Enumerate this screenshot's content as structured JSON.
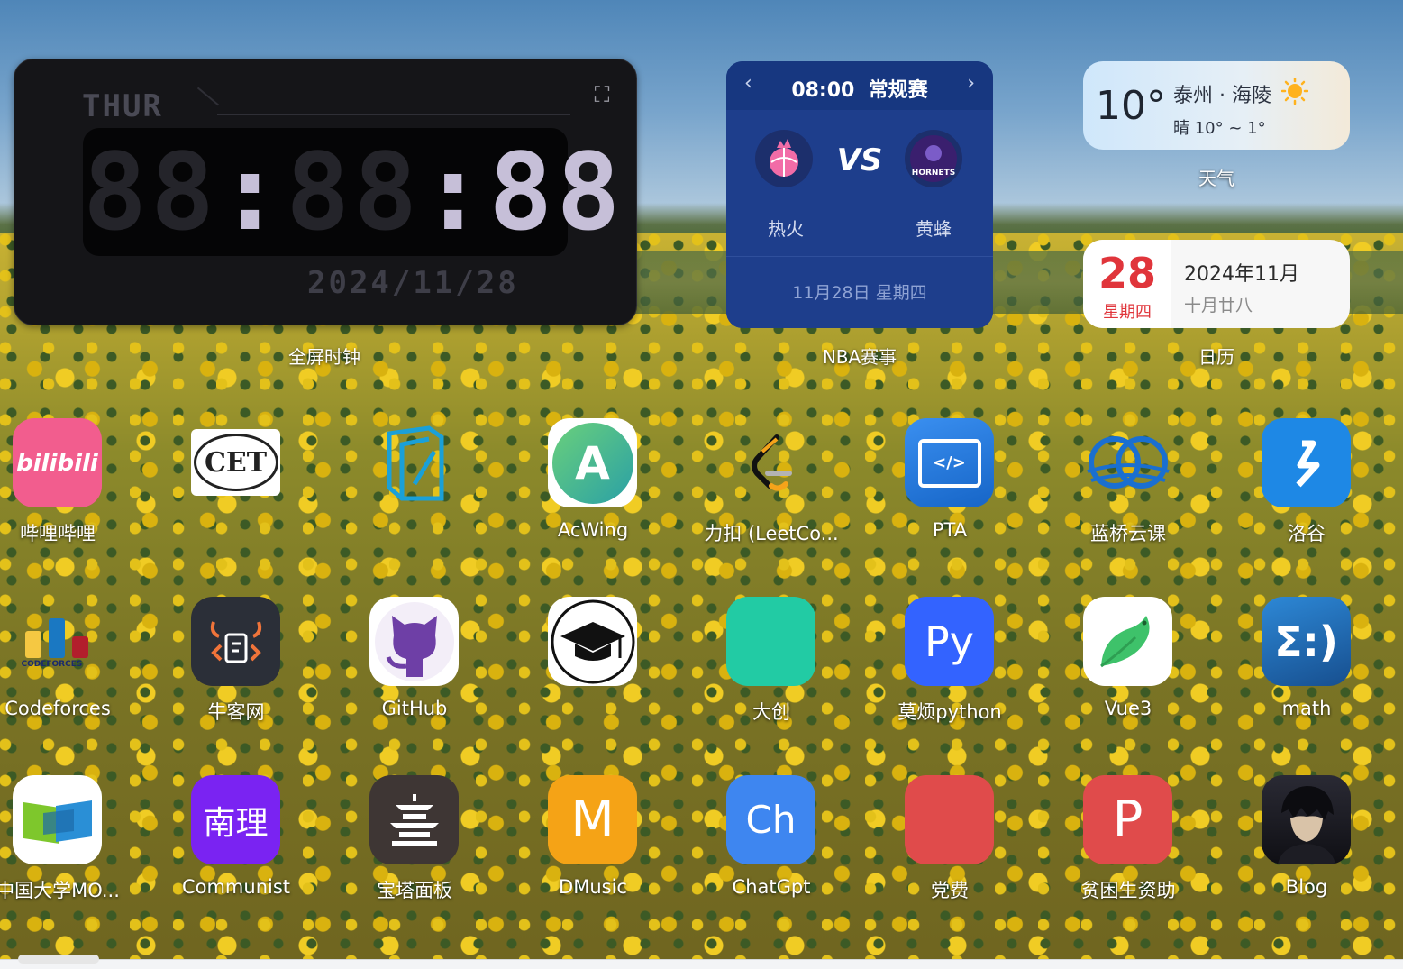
{
  "widgets": {
    "clock": {
      "day": "THUR",
      "time_dim": "88",
      "time_lit": "",
      "date": "2024/11/28",
      "label": "全屏时钟"
    },
    "nba": {
      "time": "08:00",
      "stage": "常规赛",
      "vs": "VS",
      "home_team": "热火",
      "away_team": "黄蜂",
      "away_logo_text": "HORNETS",
      "date": "11月28日  星期四",
      "label": "NBA赛事"
    },
    "weather": {
      "temp": "10°",
      "city": "泰州 · 海陵",
      "range": "晴 10° ~ 1°",
      "label": "天气"
    },
    "calendar": {
      "day": "28",
      "weekday": "星期四",
      "year_month": "2024年11月",
      "lunar": "十月廿八",
      "label": "日历"
    }
  },
  "apps": [
    {
      "name": "哔哩哔哩",
      "icon_text": "bilibili",
      "color": "#f25d8e"
    },
    {
      "name": "",
      "icon_text": "CET",
      "color": "#ffffff"
    },
    {
      "name": "",
      "icon_text": "",
      "color": "transparent"
    },
    {
      "name": "AcWing",
      "icon_text": "A",
      "color": "#ffffff"
    },
    {
      "name": "力扣 (LeetCo...",
      "icon_text": "",
      "color": "transparent"
    },
    {
      "name": "PTA",
      "icon_text": "</>",
      "color": "#1f7ae0"
    },
    {
      "name": "蓝桥云课",
      "icon_text": "",
      "color": "transparent"
    },
    {
      "name": "洛谷",
      "icon_text": "",
      "color": "#1e88e5"
    },
    {
      "name": "Codeforces",
      "icon_text": "CODEFORCES",
      "color": "transparent"
    },
    {
      "name": "牛客网",
      "icon_text": "",
      "color": "#2b2f38"
    },
    {
      "name": "GitHub",
      "icon_text": "",
      "color": "#ffffff"
    },
    {
      "name": "",
      "icon_text": "",
      "color": "#ffffff"
    },
    {
      "name": "大创",
      "icon_text": "",
      "color": "#22cba4"
    },
    {
      "name": "莫烦python",
      "icon_text": "Py",
      "color": "#3363ff"
    },
    {
      "name": "Vue3",
      "icon_text": "",
      "color": "#ffffff"
    },
    {
      "name": "math",
      "icon_text": "Σ:)",
      "color": "#1f6fb8"
    },
    {
      "name": "中国大学MO...",
      "icon_text": "",
      "color": "#ffffff"
    },
    {
      "name": "Communist",
      "icon_text": "南理",
      "color": "#7a23f2"
    },
    {
      "name": "宝塔面板",
      "icon_text": "",
      "color": "#3e3634"
    },
    {
      "name": "DMusic",
      "icon_text": "M",
      "color": "#f5a316"
    },
    {
      "name": "ChatGpt",
      "icon_text": "Ch",
      "color": "#3e86f0"
    },
    {
      "name": "党费",
      "icon_text": "",
      "color": "#e04b4b"
    },
    {
      "name": "贫困生资助",
      "icon_text": "P",
      "color": "#e04b4b"
    },
    {
      "name": "Blog",
      "icon_text": "",
      "color": "#1a1a22"
    }
  ]
}
